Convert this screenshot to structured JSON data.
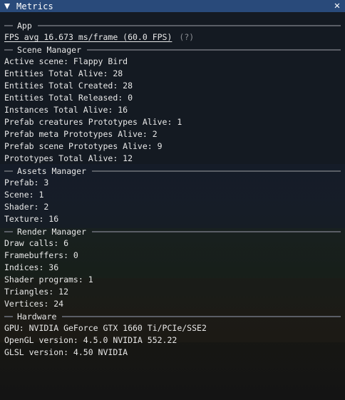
{
  "window": {
    "title": "Metrics",
    "close_icon": "close-icon",
    "collapse_icon": "triangle-down-icon"
  },
  "sections": {
    "app": {
      "header": "App",
      "fps": "FPS avg 16.673 ms/frame (60.0 FPS)",
      "help": "(?)"
    },
    "scene_manager": {
      "header": "Scene Manager",
      "rows": [
        "Active scene: Flappy Bird",
        "Entities Total Alive: 28",
        "Entities Total Created: 28",
        "Entities Total Released: 0",
        "Instances Total Alive: 16",
        "Prefab creatures Prototypes Alive: 1",
        "Prefab meta Prototypes Alive: 2",
        "Prefab scene Prototypes Alive: 9",
        "Prototypes Total Alive: 12"
      ]
    },
    "assets_manager": {
      "header": "Assets Manager",
      "rows": [
        "Prefab: 3",
        "Scene: 1",
        "Shader: 2",
        "Texture: 16"
      ]
    },
    "render_manager": {
      "header": "Render Manager",
      "rows": [
        "Draw calls: 6",
        "Framebuffers: 0",
        "Indices: 36",
        "Shader programs: 1",
        "Triangles: 12",
        "Vertices: 24"
      ]
    },
    "hardware": {
      "header": "Hardware",
      "rows": [
        "GPU: NVIDIA GeForce GTX 1660 Ti/PCIe/SSE2",
        "OpenGL version: 4.5.0 NVIDIA 552.22",
        "GLSL version: 4.50 NVIDIA"
      ]
    }
  },
  "colors": {
    "titlebar": "#294a7a",
    "text": "#e8e8e8",
    "separator": "#5a5e66",
    "muted": "#8a8d92"
  }
}
